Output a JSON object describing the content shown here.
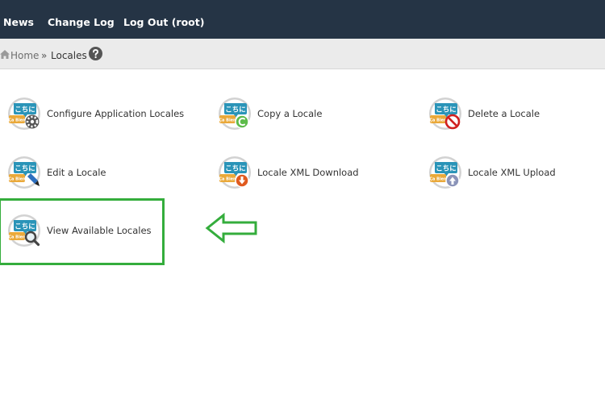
{
  "nav": {
    "items": [
      "News",
      "Change Log",
      "Log Out (root)"
    ]
  },
  "breadcrumb": {
    "home": "Home",
    "separator": "»",
    "current": "Locales",
    "help_icon": "question-circle-icon"
  },
  "tiles": [
    {
      "label": "Configure Application Locales",
      "icon": "locale-configure-icon"
    },
    {
      "label": "Copy a Locale",
      "icon": "locale-copy-icon"
    },
    {
      "label": "Delete a Locale",
      "icon": "locale-delete-icon"
    },
    {
      "label": "Edit a Locale",
      "icon": "locale-edit-icon"
    },
    {
      "label": "Locale XML Download",
      "icon": "locale-download-icon"
    },
    {
      "label": "Locale XML Upload",
      "icon": "locale-upload-icon"
    },
    {
      "label": "View Available Locales",
      "icon": "locale-view-icon"
    }
  ],
  "annotation": {
    "highlight_color": "#34ad3c",
    "arrow_direction": "left"
  },
  "colors": {
    "header_bg": "#253445",
    "breadcrumb_bg": "#ebebeb",
    "icon_teal": "#2a94b8",
    "icon_orange": "#eaa93a"
  }
}
